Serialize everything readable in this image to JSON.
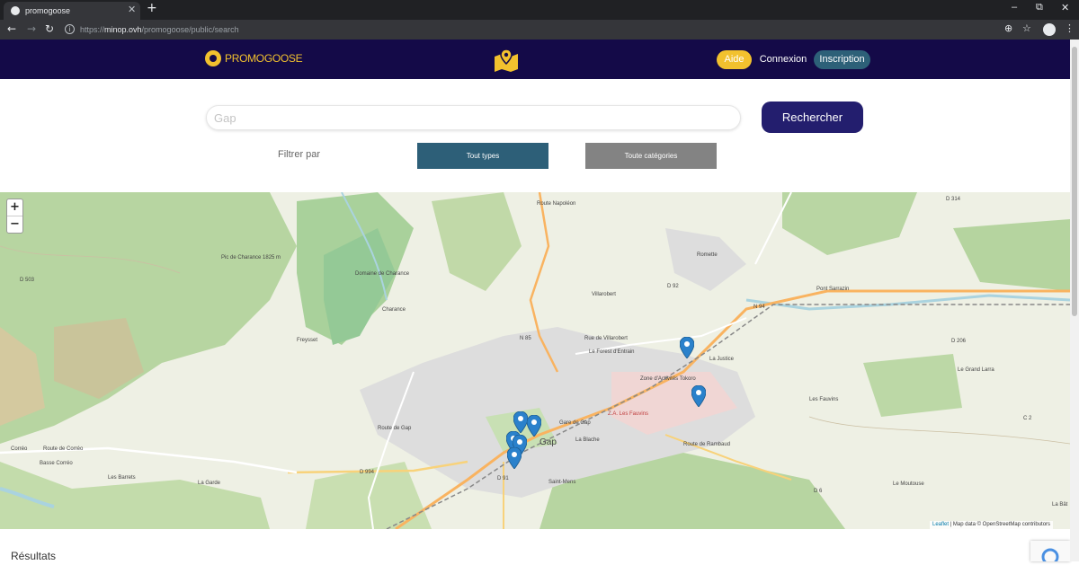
{
  "browser": {
    "tab_title": "promogoose",
    "close_glyph": "✕",
    "new_tab_glyph": "+",
    "url_scheme": "https://",
    "url_host": "minop.ovh",
    "url_path": "/promogoose/public/search",
    "window_controls": [
      "–",
      "⧉",
      "✕"
    ]
  },
  "header": {
    "logo_text": "PROMOGOOSE",
    "aide": "Aide",
    "connexion": "Connexion",
    "inscription": "Inscription"
  },
  "search": {
    "placeholder": "Gap",
    "button": "Rechercher",
    "filter_label": "Filtrer par",
    "types_selected": "Tout types",
    "categories_selected": "Toute catégories"
  },
  "map": {
    "zoom_in": "+",
    "zoom_out": "−",
    "attribution_leaflet": "Leaflet",
    "attribution_rest": " | Map data © OpenStreetMap contributors",
    "labels": [
      "Pic de Charance 1825 m",
      "Domaine de Charance",
      "Charance",
      "Freysset",
      "Villarobert",
      "Romette",
      "Pont Sarrazin",
      "La Justice",
      "Le Forest d'Entrain",
      "Zone d'Activités Tokoro",
      "Z.A. Les Fauvins",
      "Gare de Gap",
      "Gap",
      "La Blache",
      "Saint-Mens",
      "Les Fauvins",
      "Le Grand Larra",
      "Le Moutouse",
      "Corréo",
      "Basse Corréo",
      "Les Barrets",
      "La Garde",
      "D 503",
      "D 994",
      "D 91",
      "N 85",
      "D 92",
      "N 94",
      "D 314",
      "D 206",
      "C 2",
      "D 6",
      "La Bât",
      "Route Napoléon",
      "Route de Gap",
      "Route de Corréo",
      "Route de Rambaud",
      "Rue de Villarobert"
    ]
  },
  "results_heading": "Résultats",
  "colors": {
    "header_bg": "#140a48",
    "accent_yellow": "#f2c12e",
    "search_button": "#231e6e",
    "marker_blue": "#2a81cb"
  }
}
